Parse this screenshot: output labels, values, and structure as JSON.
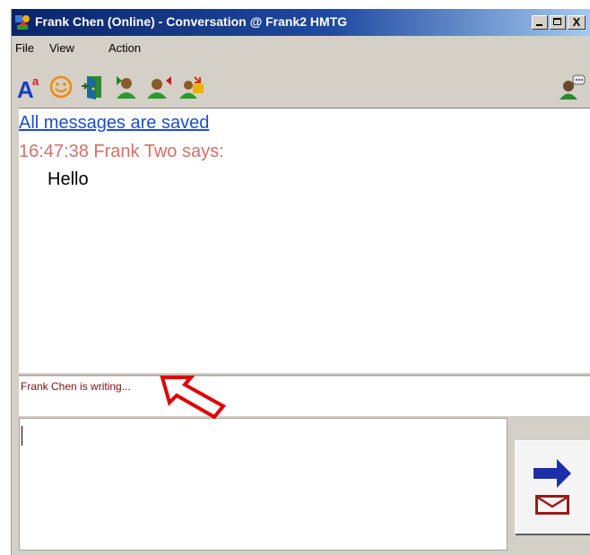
{
  "window": {
    "title": "Frank Chen (Online) - Conversation @ Frank2 HMTG",
    "close_glyph": "X"
  },
  "menu": {
    "file": "File",
    "view": "View",
    "action": "Action"
  },
  "toolbar": {
    "font_label": "A",
    "font_superscript": "a",
    "icons": [
      "font-icon",
      "emoticon-icon",
      "exit-door-icon",
      "invite-user-icon",
      "leave-user-icon",
      "send-file-icon",
      "user-chat-icon"
    ]
  },
  "conversation": {
    "saved_notice": "All messages are saved",
    "messages": [
      {
        "header": "16:47:38 Frank Two says:",
        "text": "Hello"
      }
    ]
  },
  "status": {
    "typing": "Frank Chen is writing..."
  },
  "input": {
    "value": ""
  },
  "colors": {
    "title_bar": "#0a246a",
    "link": "#1a4fd0",
    "message_header": "#d4706a",
    "status_text": "#7a1010",
    "annotation_arrow": "#e00000"
  }
}
